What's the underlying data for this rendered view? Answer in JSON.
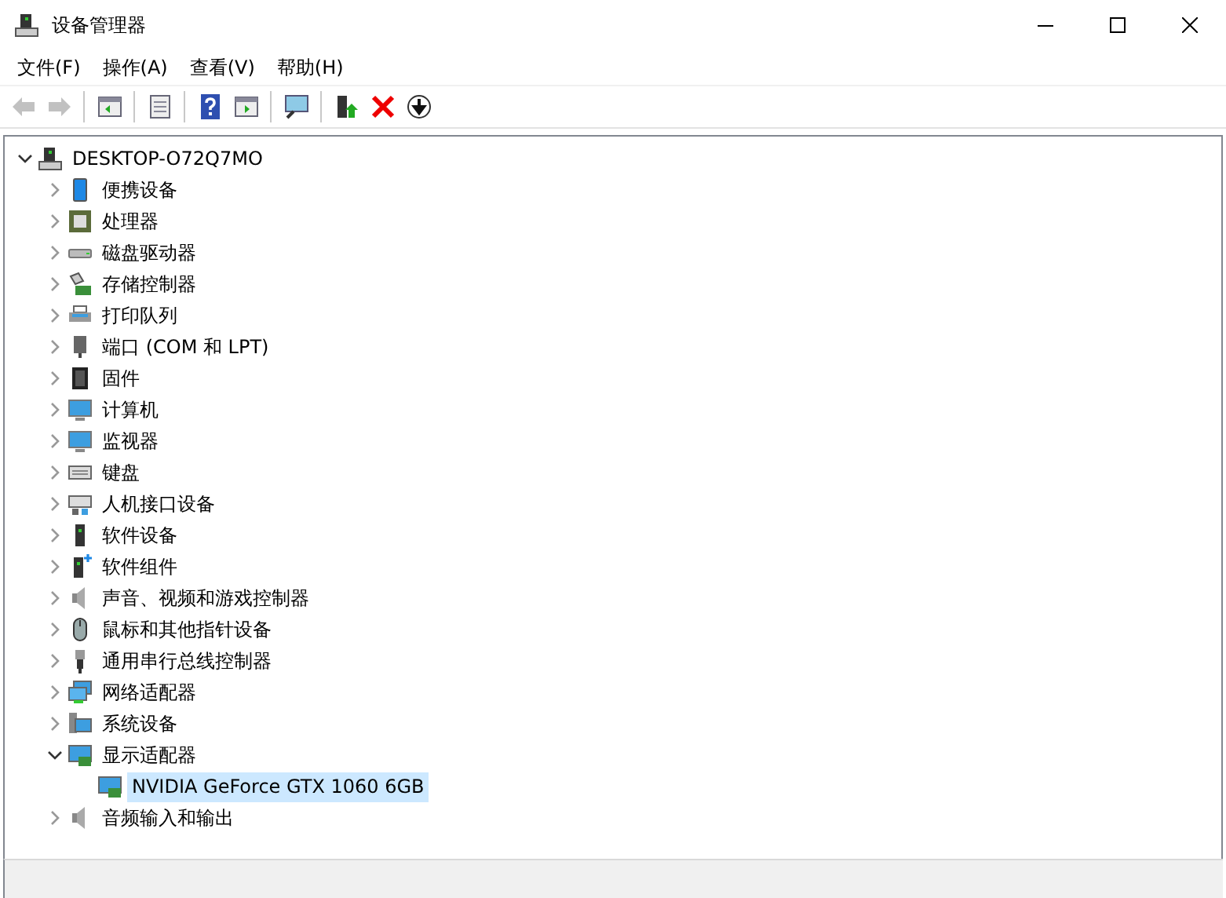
{
  "window": {
    "title": "设备管理器"
  },
  "menu": [
    "文件(F)",
    "操作(A)",
    "查看(V)",
    "帮助(H)"
  ],
  "toolbar": [
    {
      "disabled": true
    },
    {
      "disabled": true
    },
    {
      "disabled": false
    },
    {
      "disabled": false
    },
    {
      "disabled": false
    },
    {
      "disabled": false
    },
    {
      "disabled": false
    },
    {
      "disabled": false
    },
    {
      "disabled": false
    },
    {
      "disabled": false
    }
  ],
  "tree": {
    "label": "DESKTOP-O72Q7MO",
    "expanded": true,
    "selected": false,
    "children": [
      {
        "label": "便携设备",
        "expanded": false,
        "selected": false
      },
      {
        "label": "处理器",
        "expanded": false,
        "selected": false
      },
      {
        "label": "磁盘驱动器",
        "expanded": false,
        "selected": false
      },
      {
        "label": "存储控制器",
        "expanded": false,
        "selected": false
      },
      {
        "label": "打印队列",
        "expanded": false,
        "selected": false
      },
      {
        "label": "端口 (COM 和 LPT)",
        "expanded": false,
        "selected": false
      },
      {
        "label": "固件",
        "expanded": false,
        "selected": false
      },
      {
        "label": "计算机",
        "expanded": false,
        "selected": false
      },
      {
        "label": "监视器",
        "expanded": false,
        "selected": false
      },
      {
        "label": "键盘",
        "expanded": false,
        "selected": false
      },
      {
        "label": "人机接口设备",
        "expanded": false,
        "selected": false
      },
      {
        "label": "软件设备",
        "expanded": false,
        "selected": false
      },
      {
        "label": "软件组件",
        "expanded": false,
        "selected": false
      },
      {
        "label": "声音、视频和游戏控制器",
        "expanded": false,
        "selected": false
      },
      {
        "label": "鼠标和其他指针设备",
        "expanded": false,
        "selected": false
      },
      {
        "label": "通用串行总线控制器",
        "expanded": false,
        "selected": false
      },
      {
        "label": "网络适配器",
        "expanded": false,
        "selected": false
      },
      {
        "label": "系统设备",
        "expanded": false,
        "selected": false
      },
      {
        "label": "显示适配器",
        "expanded": true,
        "selected": false,
        "children": [
          {
            "label": "NVIDIA GeForce GTX 1060 6GB",
            "selected": true
          }
        ]
      },
      {
        "label": "音频输入和输出",
        "expanded": false,
        "selected": false
      }
    ]
  }
}
